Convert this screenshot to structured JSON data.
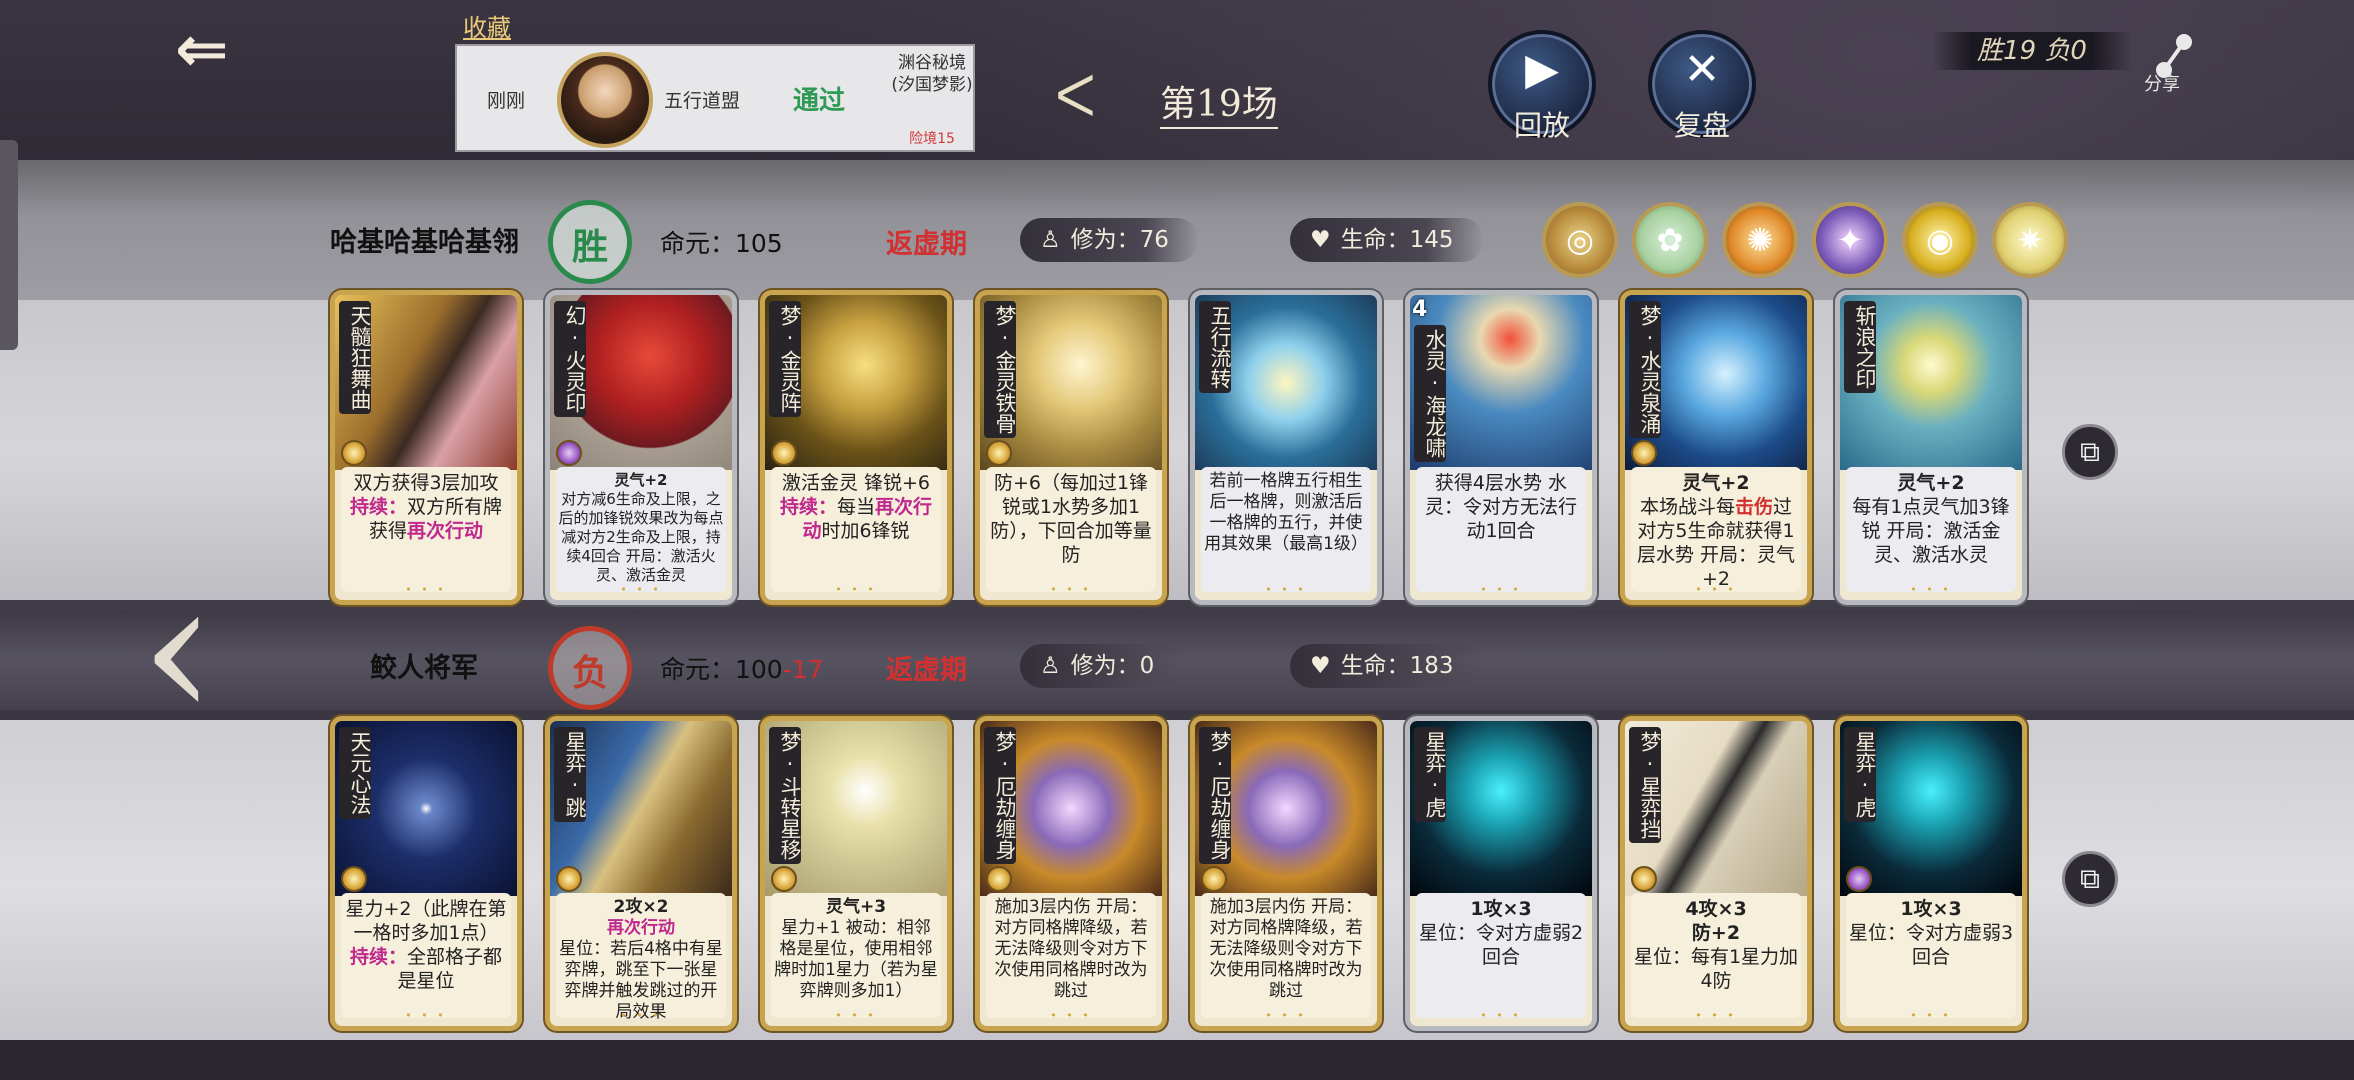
{
  "header": {
    "favorite_label": "收藏",
    "favorite": {
      "time": "刚刚",
      "sect": "五行道盟",
      "result": "通过",
      "map": "渊谷秘境(汐国梦影)",
      "danger": "险境15"
    },
    "round_title": "第19场",
    "replay_label": "回放",
    "review_label": "复盘",
    "score": "胜19  负0",
    "share_label": "分享"
  },
  "player_a": {
    "name": "哈基哈基哈基翎",
    "badge": "胜",
    "lifespan": "命元：105",
    "phase": "返虚期",
    "cultivation": "修为：76",
    "health": "生命：145",
    "relics": [
      "relic-1",
      "relic-2",
      "relic-3",
      "relic-4",
      "relic-5",
      "relic-6"
    ],
    "cards": [
      {
        "title": "天髓狂舞曲",
        "desc": "双方获得3层加攻",
        "kw": "持续：",
        "kw_text": "双方所有牌获得",
        "kw2": "再次行动"
      },
      {
        "title": "幻·火灵印",
        "desc_top": "灵气+2",
        "desc": "对方减6生命及上限，之后的加锋锐效果改为每点减对方2生命及上限，持续4回合 开局：激活火灵、激活金灵"
      },
      {
        "title": "梦·金灵阵",
        "desc": "激活金灵 锋锐+6",
        "kw": "持续：",
        "kw_text": "每当",
        "kw2": "再次行动",
        "tail": "时加6锋锐"
      },
      {
        "title": "梦·金灵铁骨",
        "desc": "防+6（每加过1锋锐或1水势多加1防），下回合加等量防"
      },
      {
        "title": "五行流转",
        "desc": "若前一格牌五行相生后一格牌，则激活后一格牌的五行，并使用其效果（最高1级）"
      },
      {
        "title": "水灵·海龙啸",
        "level": "4",
        "desc": "获得4层水势 水灵：令对方无法行动1回合"
      },
      {
        "title": "梦·水灵泉涌",
        "desc_top": "灵气+2",
        "desc_a": "本场战斗每",
        "kw_r": "击伤",
        "desc_b": "过对方5生命就获得1层水势 开局：灵气+2"
      },
      {
        "title": "斩浪之印",
        "desc_top": "灵气+2",
        "desc": "每有1点灵气加3锋锐 开局：激活金灵、激活水灵"
      }
    ]
  },
  "player_b": {
    "name": "鲛人将军",
    "badge": "负",
    "lifespan": "命元：100",
    "lifespan_loss": "-17",
    "phase": "返虚期",
    "cultivation": "修为：0",
    "health": "生命：183",
    "cards": [
      {
        "title": "天元心法",
        "desc": "星力+2（此牌在第一格时多加1点）",
        "kw": "持续：",
        "kw_text": "全部格子都是星位"
      },
      {
        "title": "星弈·跳",
        "desc_top": "2攻×2",
        "kw2": "再次行动",
        "desc": "星位：若后4格中有星弈牌，跳至下一张星弈牌并触发跳过的开局效果"
      },
      {
        "title": "梦·斗转星移",
        "desc_top": "灵气+3",
        "desc": "星力+1 被动：相邻格是星位，使用相邻牌时加1星力（若为星弈牌则多加1）"
      },
      {
        "title": "梦·厄劫缠身",
        "desc": "施加3层内伤 开局：对方同格牌降级，若无法降级则令对方下次使用同格牌时改为跳过"
      },
      {
        "title": "梦·厄劫缠身",
        "desc": "施加3层内伤 开局：对方同格牌降级，若无法降级则令对方下次使用同格牌时改为跳过"
      },
      {
        "title": "星弈·虎",
        "desc_top": "1攻×3",
        "desc": "星位：令对方虚弱2回合"
      },
      {
        "title": "梦·星弈挡",
        "desc_top": "4攻×3",
        "desc_mid": "防+2",
        "desc": "星位：每有1星力加4防"
      },
      {
        "title": "星弈·虎",
        "desc_top": "1攻×3",
        "desc": "星位：令对方虚弱3回合"
      }
    ]
  },
  "icons": {
    "back": "back-arrow-icon",
    "prev": "chevron-left-icon",
    "replay": "play-icon",
    "review": "swords-icon",
    "share": "share-icon",
    "cultivation": "meditation-icon",
    "health": "heart-icon",
    "copy": "copy-deck-icon"
  },
  "colors": {
    "win": "#2a8a4c",
    "lose": "#c03a2a",
    "phase": "#d23131",
    "again": "#c0288e",
    "spirit": "#2c87c8"
  }
}
